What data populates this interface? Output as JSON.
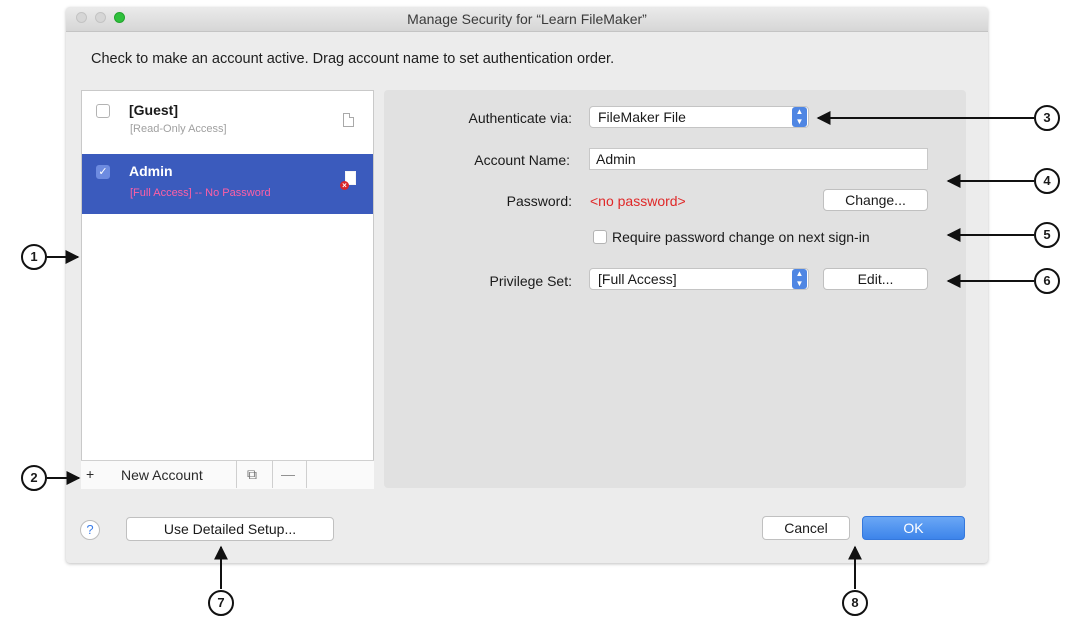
{
  "window": {
    "title": "Manage Security for “Learn FileMaker”",
    "instructions": "Check to make an account active.  Drag account name to set authentication order."
  },
  "accounts": [
    {
      "name": "[Guest]",
      "access": "[Read-Only Access]",
      "active": false,
      "selected": false,
      "icon": "document-icon"
    },
    {
      "name": "Admin",
      "access": "[Full Access] -- No Password",
      "active": true,
      "selected": true,
      "icon": "document-warning-icon"
    }
  ],
  "list_toolbar": {
    "add_symbol": "+",
    "new_account_label": "New Account",
    "duplicate_symbol": "⧉",
    "remove_symbol": "—"
  },
  "details": {
    "authenticate_label": "Authenticate via:",
    "authenticate_value": "FileMaker File",
    "account_name_label": "Account Name:",
    "account_name_value": "Admin",
    "password_label": "Password:",
    "password_value": "<no password>",
    "change_button": "Change...",
    "require_change_label": "Require password change on next sign-in",
    "require_change_checked": false,
    "privilege_label": "Privilege Set:",
    "privilege_value": "[Full Access]",
    "edit_button": "Edit..."
  },
  "footer": {
    "help_symbol": "?",
    "detailed_setup_button": "Use Detailed Setup...",
    "cancel_button": "Cancel",
    "ok_button": "OK"
  },
  "callouts": [
    "1",
    "2",
    "3",
    "4",
    "5",
    "6",
    "7",
    "8"
  ],
  "colors": {
    "selection": "#3b5bbd",
    "accent": "#4f86e3",
    "error_text": "#e02828",
    "panel": "#e1e1e1",
    "window": "#ececec"
  }
}
